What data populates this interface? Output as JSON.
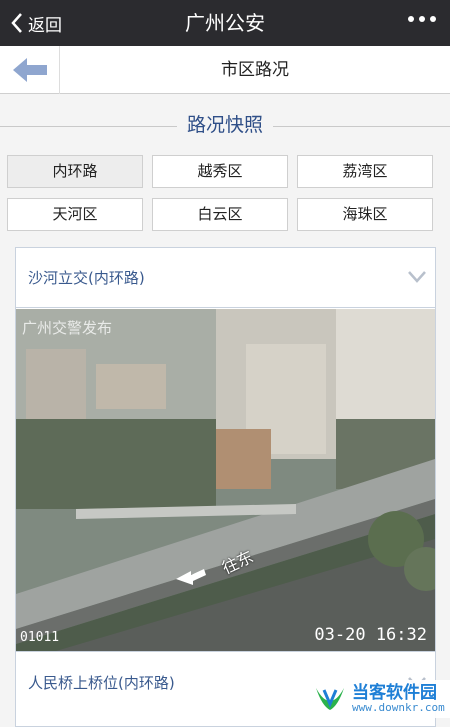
{
  "nav": {
    "back_label": "返回",
    "title": "广州公安"
  },
  "subbar": {
    "title": "市区路况"
  },
  "section": {
    "title": "路况快照"
  },
  "districts": [
    {
      "label": "内环路",
      "active": true
    },
    {
      "label": "越秀区",
      "active": false
    },
    {
      "label": "荔湾区",
      "active": false
    },
    {
      "label": "天河区",
      "active": false
    },
    {
      "label": "白云区",
      "active": false
    },
    {
      "label": "海珠区",
      "active": false
    }
  ],
  "cameras": [
    {
      "name": "沙河立交(内环路)",
      "watermark": "广州交警发布",
      "camera_id": "01011",
      "timestamp": "03-20 16:32",
      "direction_text": "往东"
    },
    {
      "name": "人民桥上桥位(内环路)"
    }
  ],
  "branding": {
    "name": "当客软件园",
    "url": "www.downkr.com"
  },
  "colors": {
    "nav_bg": "#2b2b2f",
    "accent": "#2f4f88",
    "link": "#3a5a8e"
  }
}
